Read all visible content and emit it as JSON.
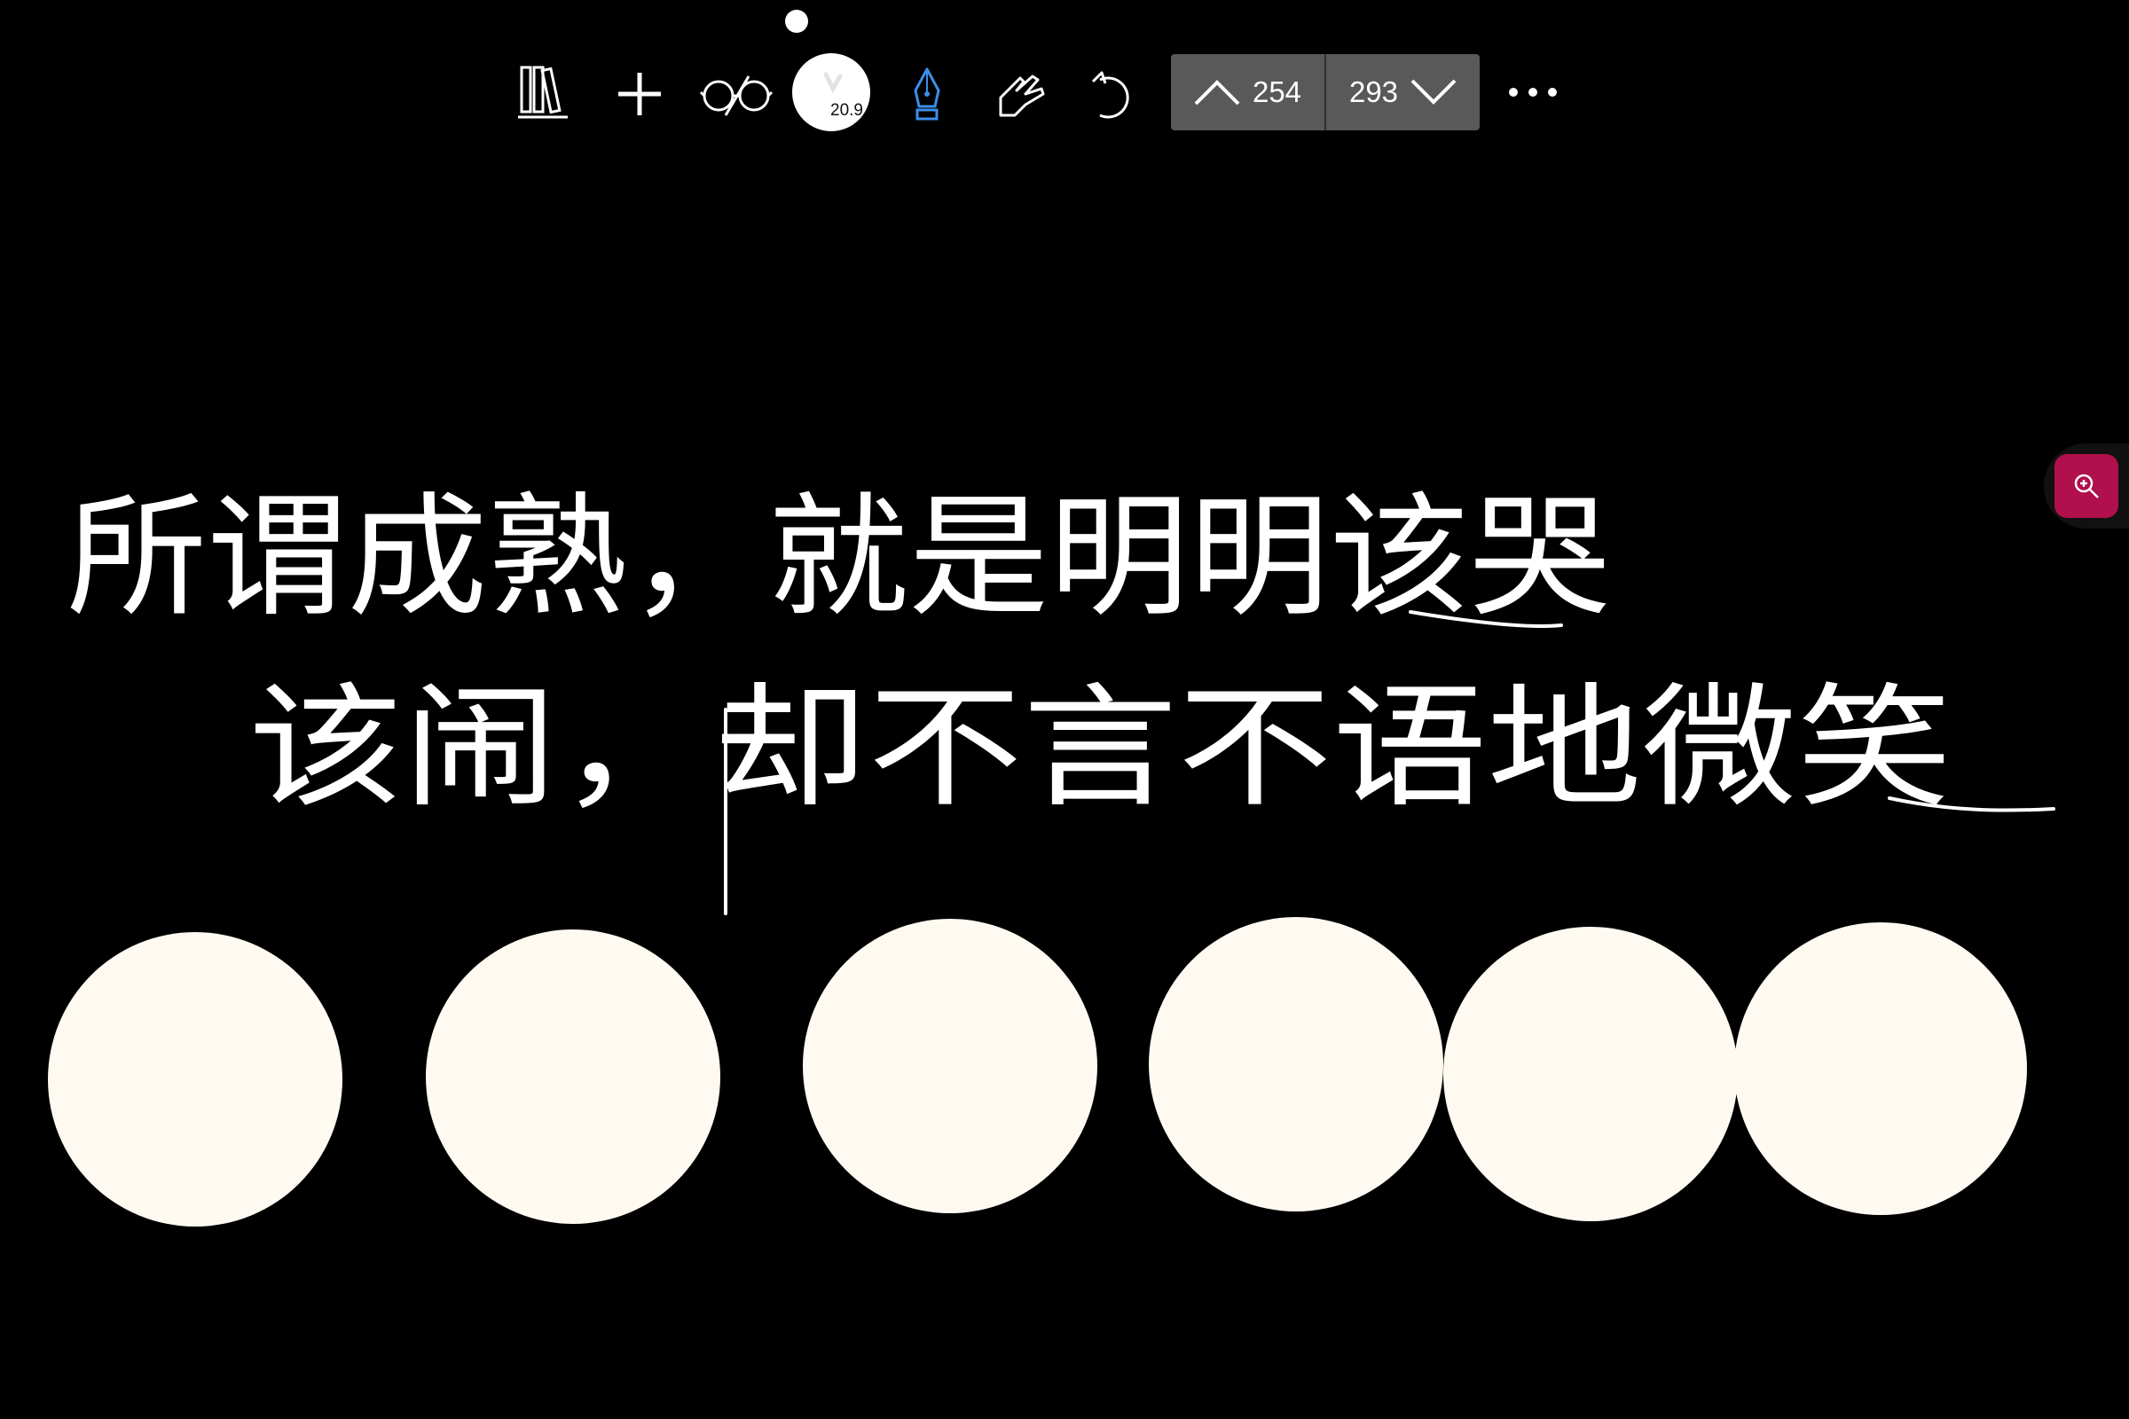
{
  "toolbar": {
    "icons": [
      "library-icon",
      "add-icon",
      "glasses-icon",
      "brush-size",
      "pen-icon",
      "hand-icon",
      "undo-icon",
      "more-icon"
    ],
    "brush_size": "20.9",
    "page_prev": "254",
    "page_next": "293"
  },
  "canvas": {
    "line1": "所谓成熟，就是明明该哭",
    "line2": "该闹，却不言不语地微笑"
  },
  "colors": {
    "background": "#000000",
    "ink": "#ffffff",
    "circle": "#fffaf1",
    "pager": "#595959",
    "zoom_button": "#b0104c",
    "pen_accent": "#3b8ee8"
  }
}
